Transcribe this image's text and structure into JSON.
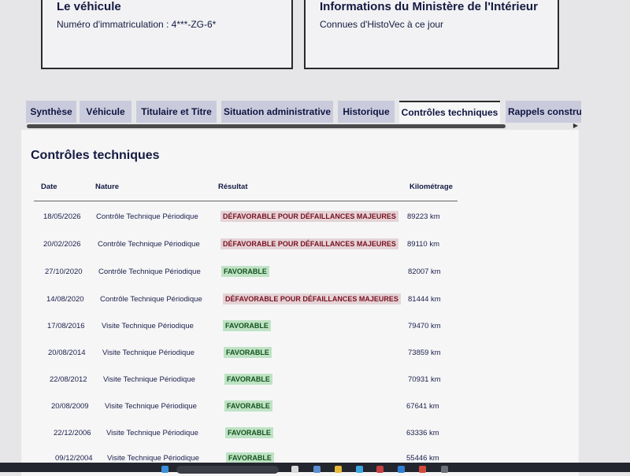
{
  "vehicle_card": {
    "title": "Le véhicule",
    "plate_label": "Numéro d'immatriculation : 4***-ZG-6*"
  },
  "ministry_card": {
    "title": "Informations du Ministère de l'Intérieur",
    "text": "Connues d'HistoVec à ce jour"
  },
  "tabs": [
    {
      "label": "Synthèse",
      "active": false
    },
    {
      "label": "Véhicule",
      "active": false
    },
    {
      "label": "Titulaire et Titre",
      "active": false
    },
    {
      "label": "Situation administrative",
      "active": false
    },
    {
      "label": "Historique",
      "active": false
    },
    {
      "label": "Contrôles techniques",
      "active": true
    },
    {
      "label": "Rappels constru",
      "active": false
    }
  ],
  "section": {
    "title": "Contrôles techniques",
    "columns": {
      "date": "Date",
      "nature": "Nature",
      "result": "Résultat",
      "mileage": "Kilométrage"
    },
    "rows": [
      {
        "date": "18/05/2026",
        "nature": "Contrôle Technique Périodique",
        "result": "DÉFAVORABLE POUR DÉFAILLANCES MAJEURES",
        "status": "unfavorable",
        "mileage": "89223 km"
      },
      {
        "date": "20/02/2026",
        "nature": "Contrôle Technique Périodique",
        "result": "DÉFAVORABLE POUR DÉFAILLANCES MAJEURES",
        "status": "unfavorable",
        "mileage": "89110 km"
      },
      {
        "date": "27/10/2020",
        "nature": "Contrôle Technique Périodique",
        "result": "FAVORABLE",
        "status": "favorable",
        "mileage": "82007 km"
      },
      {
        "date": "14/08/2020",
        "nature": "Contrôle Technique Périodique",
        "result": "DÉFAVORABLE POUR DÉFAILLANCES MAJEURES",
        "status": "unfavorable",
        "mileage": "81444 km"
      },
      {
        "date": "17/08/2016",
        "nature": "Visite Technique Périodique",
        "result": "FAVORABLE",
        "status": "favorable",
        "mileage": "79470 km"
      },
      {
        "date": "20/08/2014",
        "nature": "Visite Technique Périodique",
        "result": "FAVORABLE",
        "status": "favorable",
        "mileage": "73859 km"
      },
      {
        "date": "22/08/2012",
        "nature": "Visite Technique Périodique",
        "result": "FAVORABLE",
        "status": "favorable",
        "mileage": "70931 km"
      },
      {
        "date": "20/08/2009",
        "nature": "Visite Technique Périodique",
        "result": "FAVORABLE",
        "status": "favorable",
        "mileage": "67641 km"
      },
      {
        "date": "22/12/2006",
        "nature": "Visite Technique Périodique",
        "result": "FAVORABLE",
        "status": "favorable",
        "mileage": "63336 km"
      },
      {
        "date": "09/12/2004",
        "nature": "Visite Technique Périodique",
        "result": "FAVORABLE",
        "status": "favorable",
        "mileage": "55446 km"
      }
    ]
  },
  "colors": {
    "unfavorable_text": "#7a1020",
    "unfavorable_bg": "#e4d3d6",
    "favorable_text": "#14531f",
    "favorable_bg": "#bfe3c4",
    "tab_bg": "#c9cbdd",
    "text": "#141a40"
  }
}
